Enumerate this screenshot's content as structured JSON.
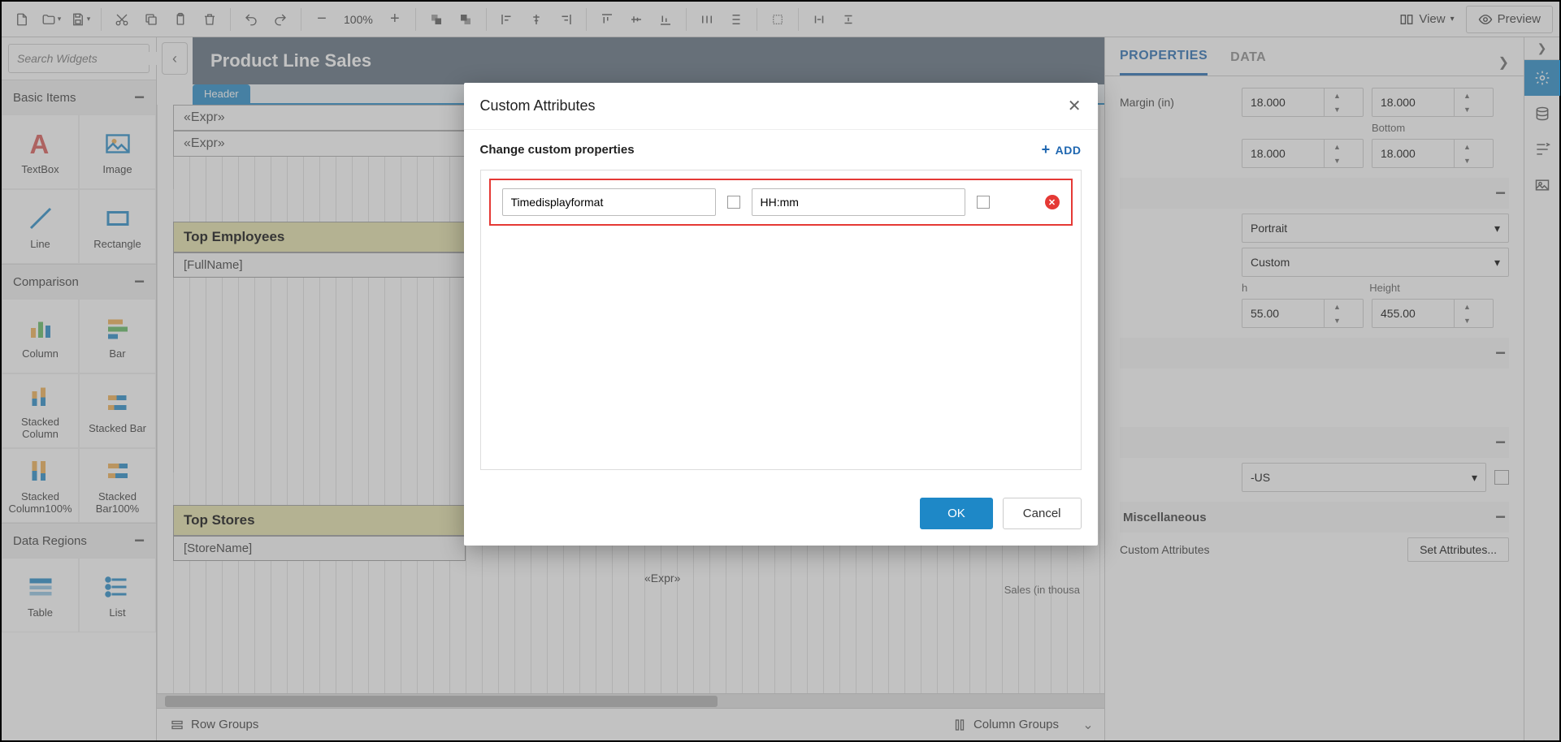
{
  "toolbar": {
    "zoom": "100%",
    "view_label": "View",
    "preview_label": "Preview"
  },
  "sidebar": {
    "search_placeholder": "Search Widgets",
    "sections": {
      "basic": {
        "title": "Basic Items",
        "items": [
          "TextBox",
          "Image",
          "Line",
          "Rectangle"
        ]
      },
      "comparison": {
        "title": "Comparison",
        "items": [
          "Column",
          "Bar",
          "Stacked Column",
          "Stacked Bar",
          "Stacked Column100%",
          "Stacked Bar100%"
        ]
      },
      "data_regions": {
        "title": "Data Regions",
        "items": [
          "Table",
          "List"
        ]
      }
    }
  },
  "canvas": {
    "title": "Product Line Sales",
    "tab": "Header",
    "expr1": "«Expr»",
    "expr2": "«Expr»",
    "section1_title": "Top Employees",
    "section1_field": "[FullName]",
    "section2_title": "Top Stores",
    "section2_field": "[StoreName]",
    "chart_expr": "«Expr»",
    "axis_label": "Sales (in thousa",
    "row_groups": "Row Groups",
    "column_groups": "Column Groups"
  },
  "right": {
    "tabs": {
      "properties": "PROPERTIES",
      "data": "DATA"
    },
    "margin_label": "Margin (in)",
    "margin_top": "18.000",
    "margin_right": "18.000",
    "bottom_label": "Bottom",
    "margin_left": "18.000",
    "margin_bottom": "18.000",
    "orientation": "Portrait",
    "paper": "Custom",
    "width_label": "h",
    "height_label": "Height",
    "width_val": "55.00",
    "height_val": "455.00",
    "locale": "-US",
    "misc_title": "Miscellaneous",
    "custom_attr_label": "Custom Attributes",
    "set_attr_btn": "Set Attributes..."
  },
  "modal": {
    "title": "Custom Attributes",
    "subtitle": "Change custom properties",
    "add_label": "ADD",
    "row_name": "Timedisplayformat",
    "row_value": "HH:mm",
    "ok": "OK",
    "cancel": "Cancel"
  }
}
